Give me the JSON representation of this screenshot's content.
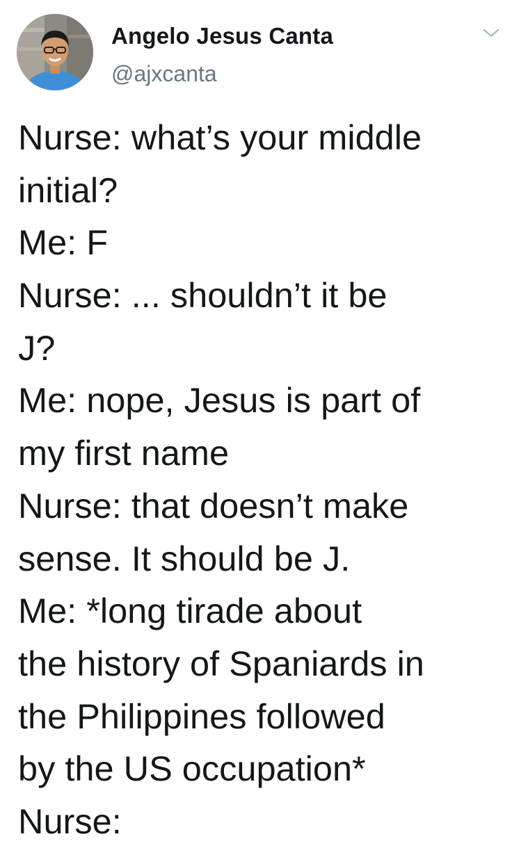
{
  "author": {
    "display_name": "Angelo Jesus Canta",
    "handle": "@ajxcanta",
    "avatar_icon": "profile-photo",
    "menu_icon": "chevron-down-icon"
  },
  "tweet": {
    "lines": [
      "Nurse: what’s your middle",
      "initial?",
      "Me: F",
      "Nurse: ... shouldn’t it be",
      "J?",
      "Me: nope, Jesus is part of",
      "my first name",
      "Nurse: that doesn’t make",
      "sense. It should be J.",
      "Me: *long tirade about",
      "the history of Spaniards in",
      "the Philippines followed",
      "by the US occupation*",
      "Nurse:"
    ]
  },
  "colors": {
    "text": "#14171a",
    "secondary_text": "#657786",
    "background": "#ffffff"
  }
}
